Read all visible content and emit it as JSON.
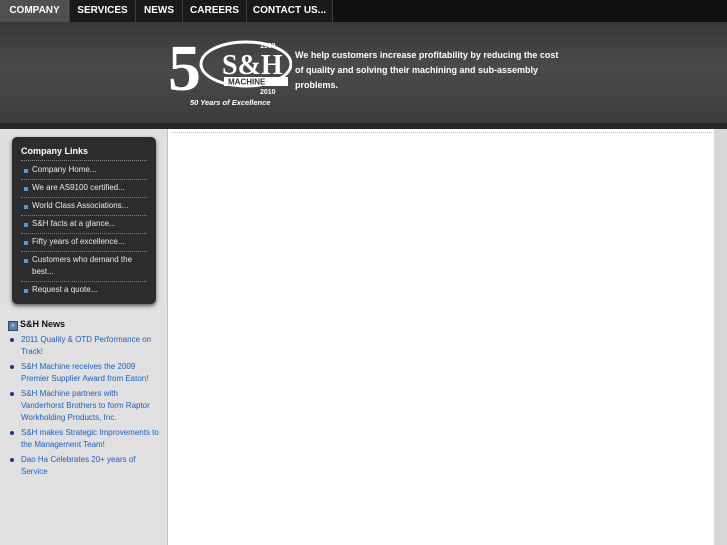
{
  "nav": {
    "tabs": [
      {
        "label": "COMPANY",
        "active": true
      },
      {
        "label": "SERVICES",
        "active": false
      },
      {
        "label": "NEWS",
        "active": false
      },
      {
        "label": "CAREERS",
        "active": false
      },
      {
        "label": "CONTACT US...",
        "active": false
      }
    ]
  },
  "header": {
    "logo": {
      "big_number": "5",
      "initials": "S&H",
      "year_start": "1960",
      "company": "MACHINE",
      "year_end": "2010",
      "slogan": "50 Years of Excellence"
    },
    "tagline": "We help customers increase profitability by reducing the cost of quality and solving their machining and sub-assembly problems."
  },
  "sidebar": {
    "links_title": "Company Links",
    "links": [
      "Company Home...",
      "We are AS9100 certified...",
      "World Class Associations...",
      "S&H facts at a glance...",
      "Fifty years of excellence...",
      "Customers who demand the best...",
      "Request a quote..."
    ],
    "news_title": "S&H News",
    "news": [
      "2011 Quality & OTD Performance on Track!",
      "S&H Machine receives the 2009 Premier Supplier Award from Eaton!",
      "S&H Machine partners with Vanderhorst Brothers to form Raptor Workholding Products, Inc.",
      "S&H makes Strategic Improvements to the Management Team!",
      "Dao Ha Celebrates 20+ years of Service"
    ]
  },
  "colors": {
    "nav_bg": "#1a1a1a",
    "nav_active": "#505050",
    "header_bg": "#444444",
    "sidebar_bg": "#e0e0e0",
    "link_box_bg": "#2c2c2c",
    "news_link": "#2060c0",
    "bullet_blue": "#4a9be0"
  }
}
